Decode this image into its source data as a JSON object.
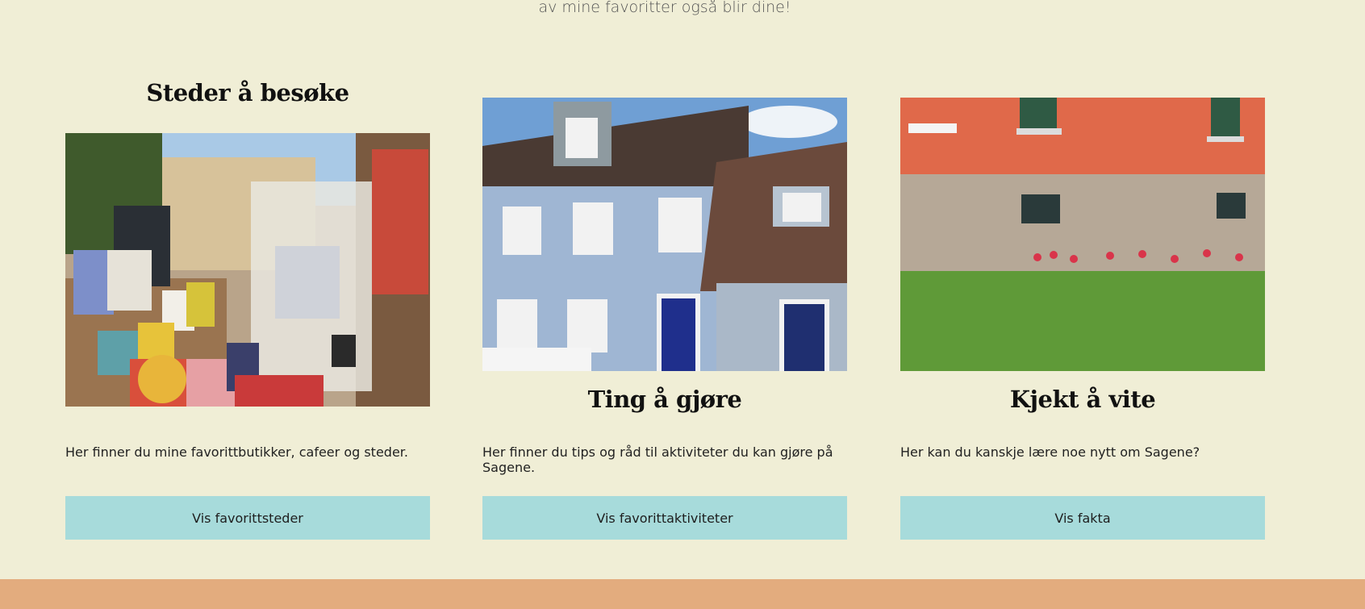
{
  "intro": {
    "text": "av mine favoritter også blir dine!"
  },
  "cards": [
    {
      "title": "Steder å besøke",
      "description": "Her finner du mine favorittbutikker, cafeer og steder.",
      "button_label": "Vis favorittsteder"
    },
    {
      "title": "Ting å gjøre",
      "description": "Her finner du tips og råd til aktiviteter du kan gjøre på Sagene.",
      "button_label": "Vis favorittaktiviteter"
    },
    {
      "title": "Kjekt å vite",
      "description": "Her kan du kanskje lære noe nytt om Sagene?",
      "button_label": "Vis fakta"
    }
  ],
  "colors": {
    "background": "#f0eed6",
    "button": "#a7dbdb",
    "footer": "#e3ac7e"
  }
}
